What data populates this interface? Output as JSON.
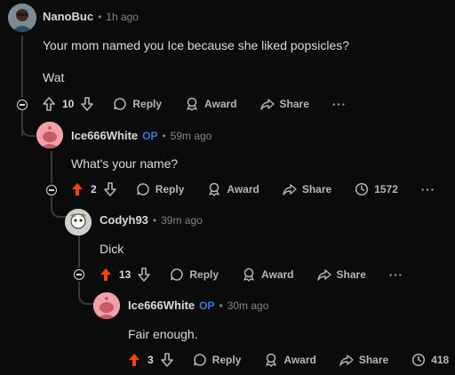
{
  "comments": [
    {
      "user": "NanoBuc",
      "time": "1h ago",
      "body": [
        "Your mom named you Ice because she liked popsicles?",
        "Wat"
      ],
      "score": "10",
      "actions": {
        "reply": "Reply",
        "award": "Award",
        "share": "Share",
        "more": "···"
      }
    },
    {
      "user": "Ice666White",
      "op": "OP",
      "time": "59m ago",
      "body": [
        "What's your name?"
      ],
      "score": "2",
      "views": "1572",
      "actions": {
        "reply": "Reply",
        "award": "Award",
        "share": "Share",
        "more": "···"
      }
    },
    {
      "user": "Codyh93",
      "time": "39m ago",
      "body": [
        "Dick"
      ],
      "score": "13",
      "actions": {
        "reply": "Reply",
        "award": "Award",
        "share": "Share",
        "more": "···"
      }
    },
    {
      "user": "Ice666White",
      "op": "OP",
      "time": "30m ago",
      "body": [
        "Fair enough."
      ],
      "score": "3",
      "views": "418",
      "actions": {
        "reply": "Reply",
        "award": "Award",
        "share": "Share"
      }
    }
  ],
  "meta": {
    "dot": "•"
  },
  "colors": {
    "upvote": "#ff4500",
    "op": "#3a76d6",
    "background": "#0b0b0b"
  }
}
